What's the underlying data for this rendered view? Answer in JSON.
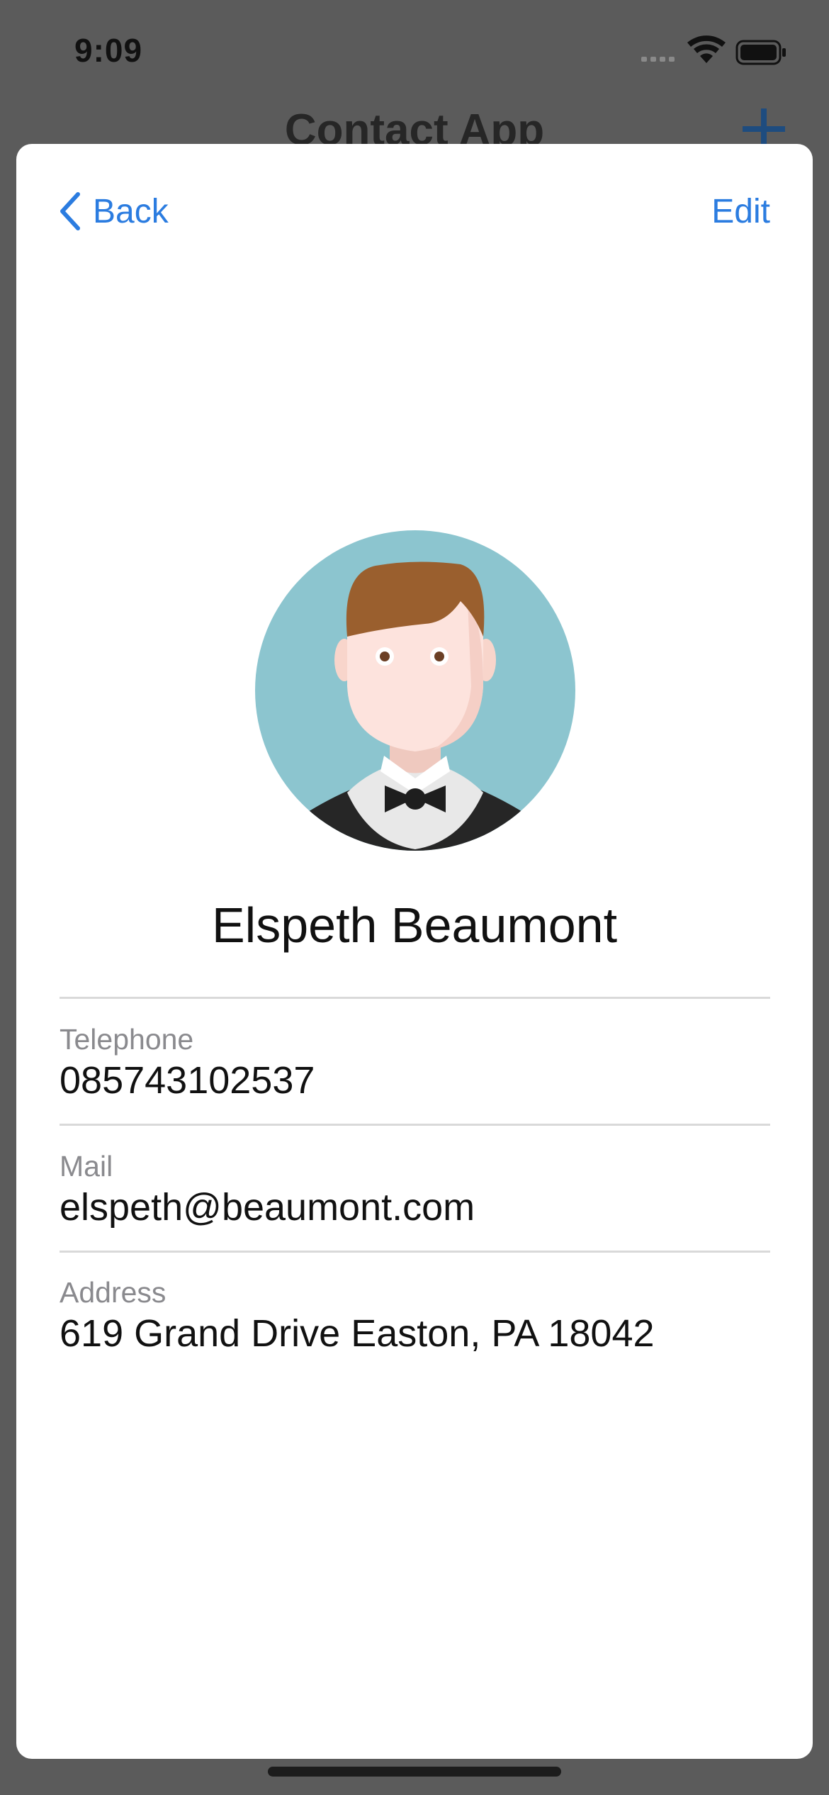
{
  "status_bar": {
    "time": "9:09"
  },
  "background_screen": {
    "title": "Contact App"
  },
  "nav": {
    "back_label": "Back",
    "edit_label": "Edit"
  },
  "contact": {
    "name": "Elspeth Beaumont",
    "fields": [
      {
        "label": "Telephone",
        "value": "085743102537"
      },
      {
        "label": "Mail",
        "value": "elspeth@beaumont.com"
      },
      {
        "label": "Address",
        "value": "619 Grand Drive Easton, PA 18042"
      }
    ]
  },
  "colors": {
    "accent": "#2b7ce0",
    "avatar_background": "#8cc5cf",
    "hair": "#9a5f2e"
  }
}
